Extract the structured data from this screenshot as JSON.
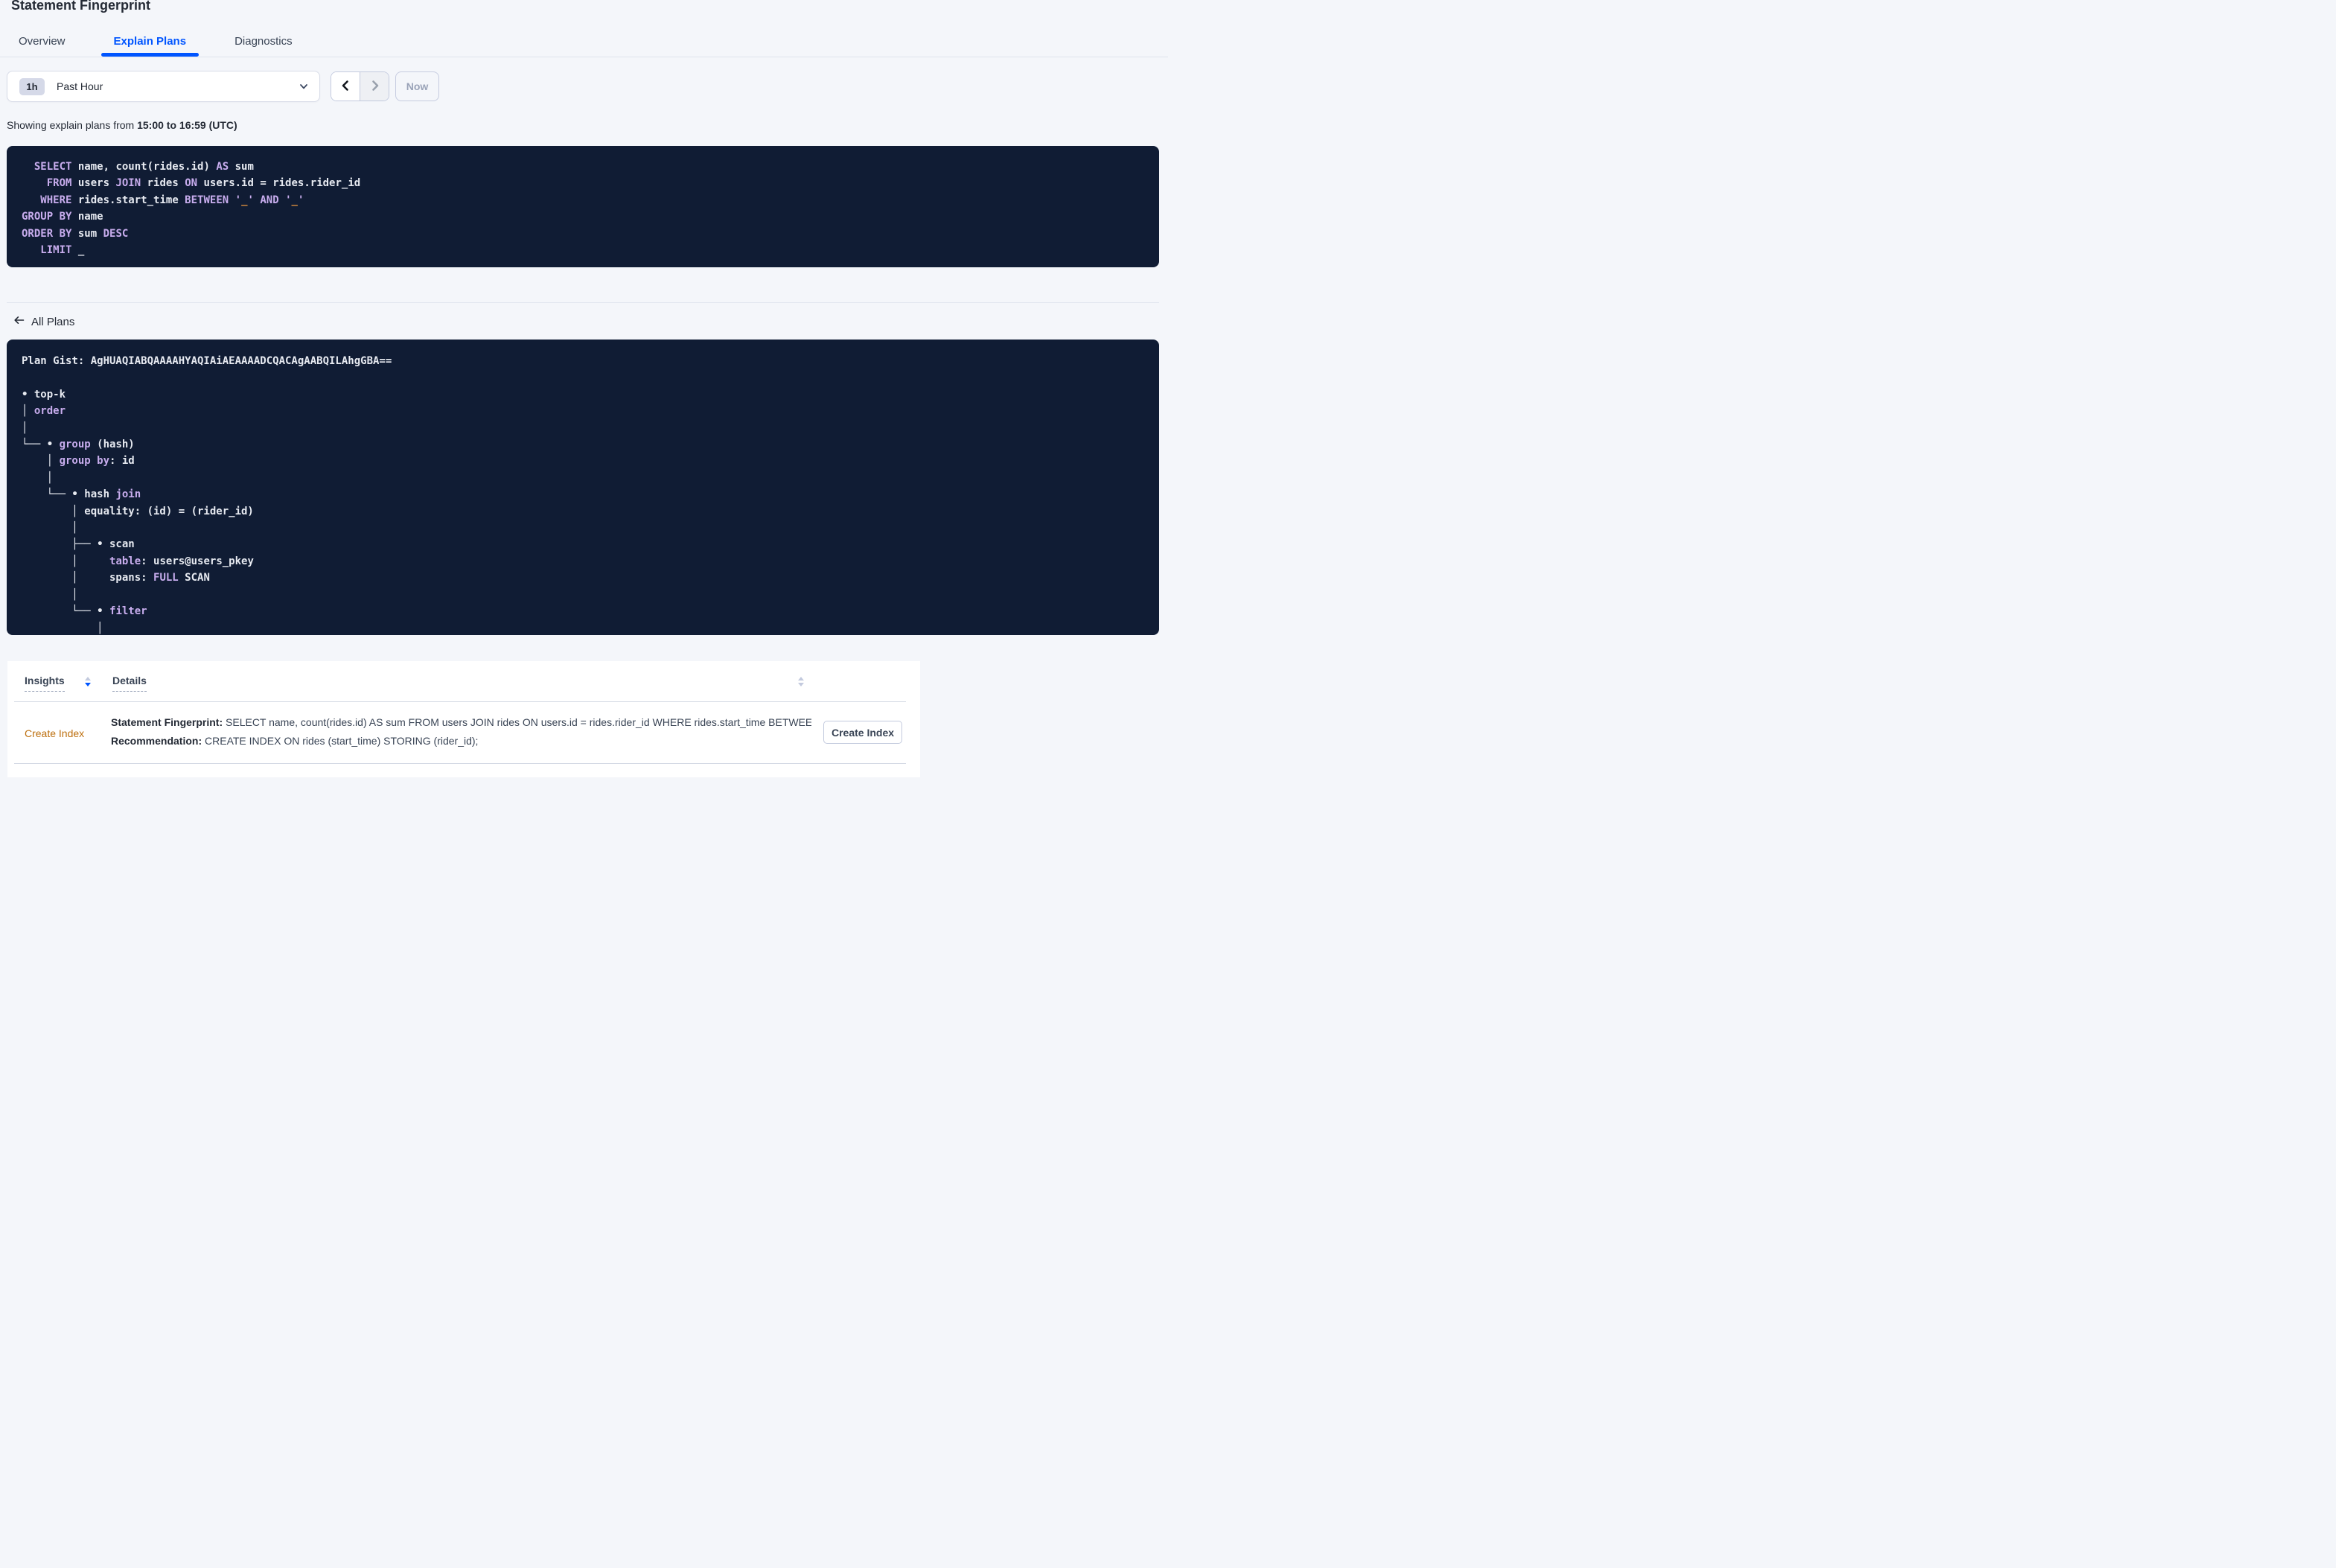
{
  "page": {
    "title": "Statement Fingerprint"
  },
  "tabs": [
    {
      "label": "Overview",
      "active": false
    },
    {
      "label": "Explain Plans",
      "active": true
    },
    {
      "label": "Diagnostics",
      "active": false
    }
  ],
  "time_picker": {
    "badge": "1h",
    "label": "Past Hour",
    "now_label": "Now"
  },
  "showing": {
    "prefix": "Showing explain plans from ",
    "range": "15:00 to 16:59 (UTC)"
  },
  "sql_box": {
    "lines": [
      [
        {
          "c": "tx",
          "t": "  "
        },
        {
          "c": "kw",
          "t": "SELECT"
        },
        {
          "c": "tx",
          "t": " name, count(rides.id) "
        },
        {
          "c": "kw",
          "t": "AS"
        },
        {
          "c": "tx",
          "t": " sum"
        }
      ],
      [
        {
          "c": "tx",
          "t": "    "
        },
        {
          "c": "kw",
          "t": "FROM"
        },
        {
          "c": "tx",
          "t": " users "
        },
        {
          "c": "kw",
          "t": "JOIN"
        },
        {
          "c": "tx",
          "t": " rides "
        },
        {
          "c": "kw",
          "t": "ON"
        },
        {
          "c": "tx",
          "t": " users.id = rides.rider_id"
        }
      ],
      [
        {
          "c": "tx",
          "t": "   "
        },
        {
          "c": "kw",
          "t": "WHERE"
        },
        {
          "c": "tx",
          "t": " rides.start_time "
        },
        {
          "c": "kw",
          "t": "BETWEEN"
        },
        {
          "c": "tx",
          "t": " "
        },
        {
          "c": "kw",
          "t": "'"
        },
        {
          "c": "or",
          "t": "_"
        },
        {
          "c": "kw",
          "t": "'"
        },
        {
          "c": "tx",
          "t": " "
        },
        {
          "c": "kw",
          "t": "AND"
        },
        {
          "c": "tx",
          "t": " "
        },
        {
          "c": "kw",
          "t": "'"
        },
        {
          "c": "or",
          "t": "_"
        },
        {
          "c": "kw",
          "t": "'"
        }
      ],
      [
        {
          "c": "kw",
          "t": "GROUP BY"
        },
        {
          "c": "tx",
          "t": " name"
        }
      ],
      [
        {
          "c": "kw",
          "t": "ORDER BY"
        },
        {
          "c": "tx",
          "t": " sum "
        },
        {
          "c": "kw",
          "t": "DESC"
        }
      ],
      [
        {
          "c": "tx",
          "t": "   "
        },
        {
          "c": "kw",
          "t": "LIMIT"
        },
        {
          "c": "tx",
          "t": " _"
        }
      ]
    ]
  },
  "all_plans": {
    "label": "All Plans"
  },
  "plan_box": {
    "lines": [
      [
        {
          "c": "tx",
          "t": "Plan Gist: AgHUAQIABQAAAAHYAQIAiAEAAAADCQACAgAABQILAhgGBA=="
        }
      ],
      [],
      [
        {
          "c": "tx",
          "t": "• top-k"
        }
      ],
      [
        {
          "c": "tx",
          "t": "│ "
        },
        {
          "c": "kw",
          "t": "order"
        }
      ],
      [
        {
          "c": "tx",
          "t": "│"
        }
      ],
      [
        {
          "c": "tx",
          "t": "└── • "
        },
        {
          "c": "kw",
          "t": "group"
        },
        {
          "c": "tx",
          "t": " (hash)"
        }
      ],
      [
        {
          "c": "tx",
          "t": "    │ "
        },
        {
          "c": "kw",
          "t": "group by"
        },
        {
          "c": "tx",
          "t": ": id"
        }
      ],
      [
        {
          "c": "tx",
          "t": "    │"
        }
      ],
      [
        {
          "c": "tx",
          "t": "    └── • hash "
        },
        {
          "c": "kw",
          "t": "join"
        }
      ],
      [
        {
          "c": "tx",
          "t": "        │ equality: (id) = (rider_id)"
        }
      ],
      [
        {
          "c": "tx",
          "t": "        │"
        }
      ],
      [
        {
          "c": "tx",
          "t": "        ├── • scan"
        }
      ],
      [
        {
          "c": "tx",
          "t": "        │     "
        },
        {
          "c": "kw",
          "t": "table"
        },
        {
          "c": "tx",
          "t": ": users@users_pkey"
        }
      ],
      [
        {
          "c": "tx",
          "t": "        │     spans: "
        },
        {
          "c": "kw",
          "t": "FULL"
        },
        {
          "c": "tx",
          "t": " SCAN"
        }
      ],
      [
        {
          "c": "tx",
          "t": "        │"
        }
      ],
      [
        {
          "c": "tx",
          "t": "        └── • "
        },
        {
          "c": "kw",
          "t": "filter"
        }
      ],
      [
        {
          "c": "tx",
          "t": "            │"
        }
      ]
    ]
  },
  "insights_table": {
    "columns": [
      {
        "label": "Insights",
        "sorted": "desc"
      },
      {
        "label": "Details",
        "sorted": "none"
      }
    ],
    "rows": [
      {
        "insight_type": "Create Index",
        "fingerprint_label": "Statement Fingerprint:",
        "fingerprint_text": " SELECT name, count(rides.id) AS sum FROM users JOIN rides ON users.id = rides.rider_id WHERE rides.start_time BETWEEN '_…",
        "recommendation_label": "Recommendation:",
        "recommendation_text": " CREATE INDEX ON rides (start_time) STORING (rider_id);",
        "action_label": "Create Index"
      }
    ]
  },
  "colors": {
    "accent_blue": "#0055ff",
    "code_bg": "#101c34",
    "code_keyword": "#c8adee",
    "code_text": "#e7eaf1",
    "code_literal": "#e0913f",
    "insight_link": "#bd6f0e"
  }
}
